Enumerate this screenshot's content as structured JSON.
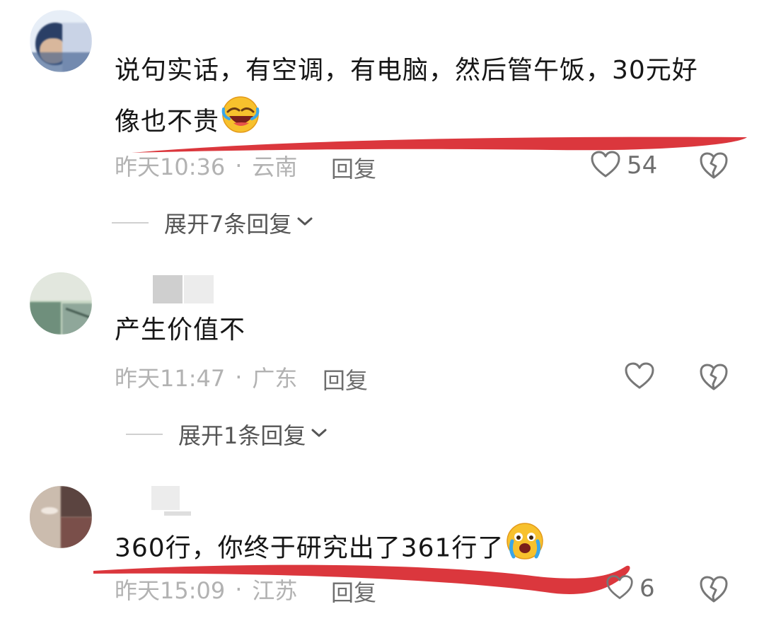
{
  "comments": [
    {
      "text_line1": "说句实话，有空调，有电脑，然后管午饭，30元好",
      "text_line2": "像也不贵",
      "emoji": "laughing-face-icon",
      "time": "昨天10:36",
      "dot": "·",
      "location": "云南",
      "reply": "回复",
      "likes": "54",
      "expand": "展开7条回复"
    },
    {
      "text_line1": "产生价值不",
      "time": "昨天11:47",
      "dot": "·",
      "location": "广东",
      "reply": "回复",
      "likes": "",
      "expand": "展开1条回复"
    },
    {
      "text_line1": "360行，你终于研究出了361行了",
      "emoji": "crying-laughing-face-icon",
      "time": "昨天15:09",
      "dot": "·",
      "location": "江苏",
      "reply": "回复",
      "likes": "6"
    }
  ],
  "colors": {
    "annotation_underline": "#d8262c",
    "meta_text": "#b2b2b2",
    "reply_text": "#6e6e6e",
    "main_text": "#161616"
  }
}
